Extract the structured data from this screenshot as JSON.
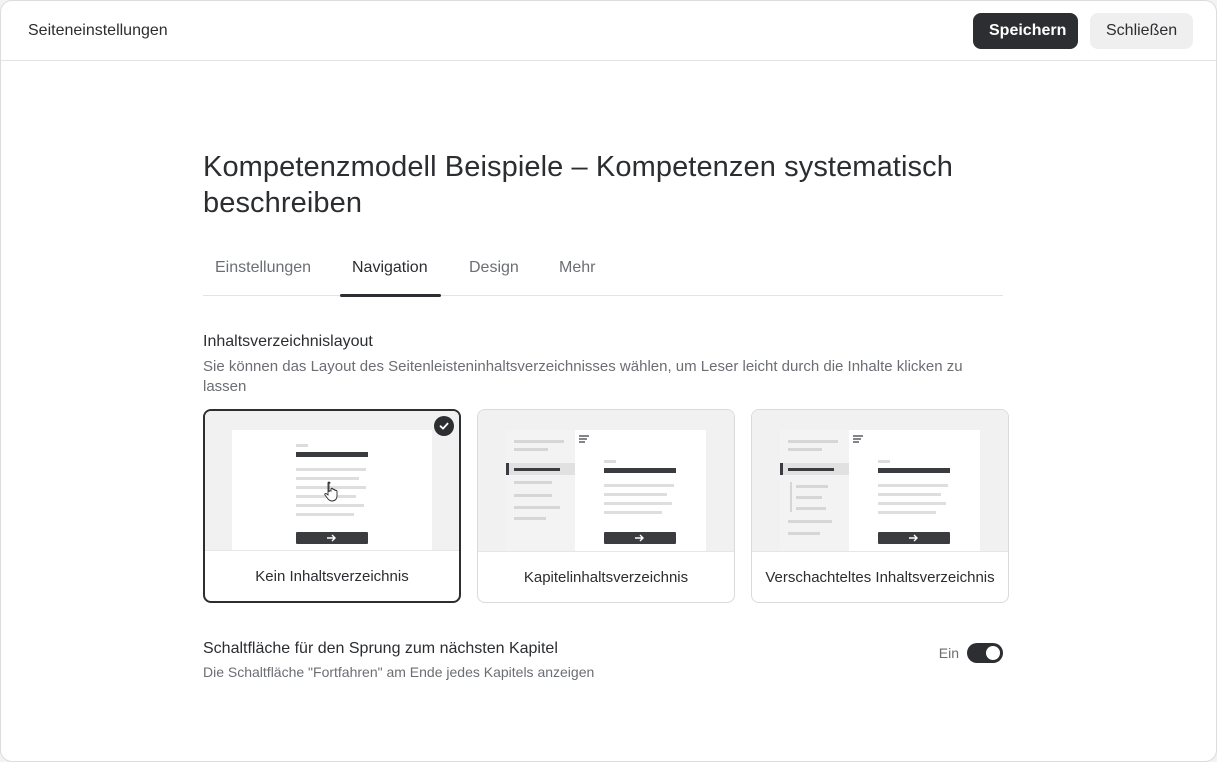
{
  "header": {
    "title": "Seiteneinstellungen",
    "save_label": "Speichern",
    "close_label": "Schließen"
  },
  "page": {
    "title": "Kompetenzmodell Beispiele – Kompetenzen systematisch beschreiben"
  },
  "tabs": [
    {
      "label": "Einstellungen",
      "active": false
    },
    {
      "label": "Navigation",
      "active": true
    },
    {
      "label": "Design",
      "active": false
    },
    {
      "label": "Mehr",
      "active": false
    }
  ],
  "toc_section": {
    "title": "Inhaltsverzeichnislayout",
    "description": "Sie können das Layout des Seitenleisteninhaltsverzeichnisses wählen, um Leser leicht durch die Inhalte klicken zu lassen",
    "options": [
      {
        "label": "Kein Inhaltsverzeichnis",
        "selected": true
      },
      {
        "label": "Kapitelinhaltsverzeichnis",
        "selected": false
      },
      {
        "label": "Verschachteltes Inhaltsverzeichnis",
        "selected": false
      }
    ]
  },
  "jump_section": {
    "title": "Schaltfläche für den Sprung zum nächsten Kapitel",
    "description": "Die Schaltfläche \"Fortfahren\" am Ende jedes Kapitels anzeigen",
    "toggle_label": "Ein",
    "toggle_on": true
  },
  "colors": {
    "primary": "#2c2e31",
    "secondary_bg": "#efefef",
    "muted_text": "#6b6e73",
    "border": "#dadada"
  }
}
